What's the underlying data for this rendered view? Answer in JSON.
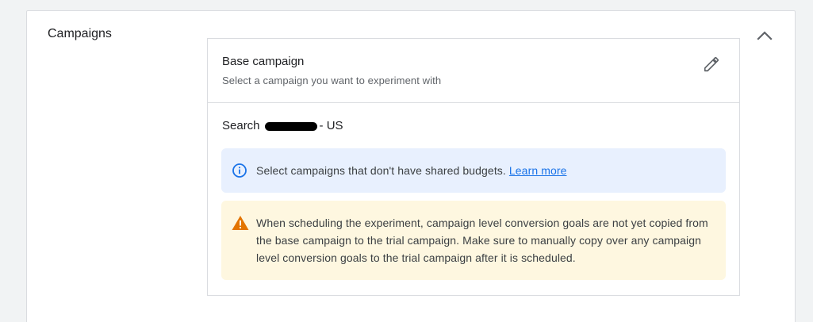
{
  "section": {
    "title": "Campaigns"
  },
  "base_campaign": {
    "title": "Base campaign",
    "subtitle": "Select a campaign you want to experiment with"
  },
  "selected_campaign": {
    "prefix": "Search",
    "suffix": "- US"
  },
  "info_notice": {
    "text": "Select campaigns that don't have shared budgets.",
    "link_label": "Learn more",
    "icon": "info-icon",
    "color": "#1a73e8"
  },
  "warning_notice": {
    "text": "When scheduling the experiment, campaign level conversion goals are not yet copied from the base campaign to the trial campaign. Make sure to manually copy over any campaign level conversion goals to the trial campaign after it is scheduled.",
    "icon": "warning-icon",
    "color": "#e37400"
  },
  "colors": {
    "info_background": "#e8f0fe",
    "warning_background": "#fef7e0"
  }
}
